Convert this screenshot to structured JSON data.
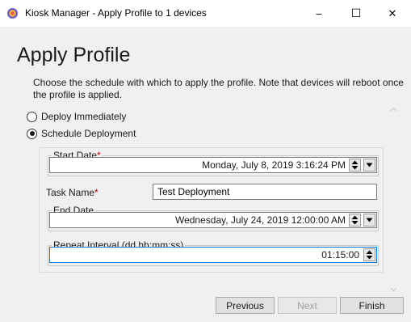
{
  "window": {
    "title": "Kiosk Manager - Apply Profile to 1 devices",
    "minimize_glyph": "–",
    "maximize_glyph": "☐",
    "close_glyph": "✕"
  },
  "page": {
    "heading": "Apply Profile",
    "description": "Choose the schedule with which to apply the profile. Note that devices will reboot once the profile is applied."
  },
  "deploy_options": [
    {
      "label": "Deploy Immediately",
      "checked": false
    },
    {
      "label": "Schedule Deployment",
      "checked": true
    }
  ],
  "schedule": {
    "start_date": {
      "label": "Start Date",
      "required_mark": "*",
      "value": "Monday, July 8, 2019 3:16:24 PM"
    },
    "task_name": {
      "label": "Task Name",
      "required_mark": "*",
      "value": "Test Deployment"
    },
    "end_date": {
      "label": "End Date",
      "value": "Wednesday, July 24, 2019 12:00:00 AM"
    },
    "repeat_interval": {
      "label": "Repeat Interval (dd.hh:mm:ss)",
      "value": "01:15:00"
    }
  },
  "buttons": {
    "previous": "Previous",
    "next": "Next",
    "finish": "Finish"
  },
  "icons": {
    "app": "kiosk-app-icon",
    "spin": "spin-up-down-icon",
    "dropdown": "chevron-down-icon"
  },
  "colors": {
    "required": "#c00000",
    "focus_border": "#0078d7",
    "window_bg": "#f0f0f0"
  }
}
